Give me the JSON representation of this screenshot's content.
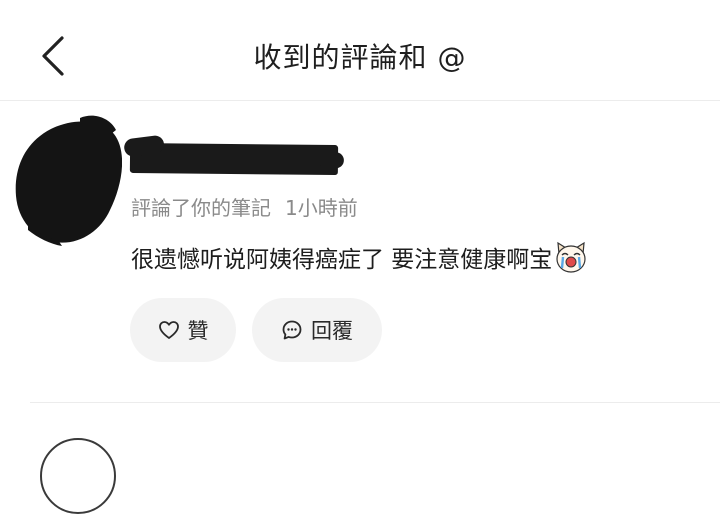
{
  "header": {
    "title": "收到的評論和 @"
  },
  "notification": {
    "action_text": "評論了你的筆記",
    "time": "1小時前",
    "comment_text": "很遗憾听说阿姨得癌症了 要注意健康啊宝",
    "like_label": "贊",
    "reply_label": "回覆"
  },
  "icons": [
    "back-icon",
    "heart-icon",
    "chat-bubble-icon",
    "crying-dog-emoji-icon"
  ]
}
